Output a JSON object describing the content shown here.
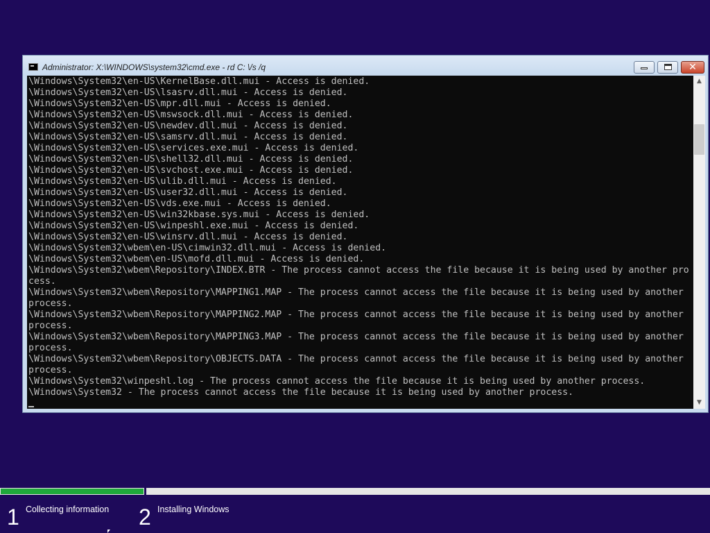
{
  "window": {
    "title": "Administrator: X:\\WINDOWS\\system32\\cmd.exe - rd  C: \\/s /q",
    "minimize_icon": "minimize-icon",
    "maximize_icon": "maximize-icon",
    "close_icon": "close-icon",
    "close_glyph": "✕"
  },
  "console": {
    "lines": [
      "\\Windows\\System32\\en-US\\KernelBase.dll.mui - Access is denied.",
      "\\Windows\\System32\\en-US\\lsasrv.dll.mui - Access is denied.",
      "\\Windows\\System32\\en-US\\mpr.dll.mui - Access is denied.",
      "\\Windows\\System32\\en-US\\mswsock.dll.mui - Access is denied.",
      "\\Windows\\System32\\en-US\\newdev.dll.mui - Access is denied.",
      "\\Windows\\System32\\en-US\\samsrv.dll.mui - Access is denied.",
      "\\Windows\\System32\\en-US\\services.exe.mui - Access is denied.",
      "\\Windows\\System32\\en-US\\shell32.dll.mui - Access is denied.",
      "\\Windows\\System32\\en-US\\svchost.exe.mui - Access is denied.",
      "\\Windows\\System32\\en-US\\ulib.dll.mui - Access is denied.",
      "\\Windows\\System32\\en-US\\user32.dll.mui - Access is denied.",
      "\\Windows\\System32\\en-US\\vds.exe.mui - Access is denied.",
      "\\Windows\\System32\\en-US\\win32kbase.sys.mui - Access is denied.",
      "\\Windows\\System32\\en-US\\winpeshl.exe.mui - Access is denied.",
      "\\Windows\\System32\\en-US\\winsrv.dll.mui - Access is denied.",
      "\\Windows\\System32\\wbem\\en-US\\cimwin32.dll.mui - Access is denied.",
      "\\Windows\\System32\\wbem\\en-US\\mofd.dll.mui - Access is denied.",
      "\\Windows\\System32\\wbem\\Repository\\INDEX.BTR - The process cannot access the file because it is being used by another pro",
      "cess.",
      "\\Windows\\System32\\wbem\\Repository\\MAPPING1.MAP - The process cannot access the file because it is being used by another",
      "process.",
      "\\Windows\\System32\\wbem\\Repository\\MAPPING2.MAP - The process cannot access the file because it is being used by another",
      "process.",
      "\\Windows\\System32\\wbem\\Repository\\MAPPING3.MAP - The process cannot access the file because it is being used by another",
      "process.",
      "\\Windows\\System32\\wbem\\Repository\\OBJECTS.DATA - The process cannot access the file because it is being used by another",
      "process.",
      "\\Windows\\System32\\winpeshl.log - The process cannot access the file because it is being used by another process.",
      "\\Windows\\System32 - The process cannot access the file because it is being used by another process."
    ]
  },
  "scrollbar": {
    "up_glyph": "▲",
    "down_glyph": "▼"
  },
  "setup": {
    "steps": [
      {
        "number": "1",
        "label": "Collecting information"
      },
      {
        "number": "2",
        "label": "Installing Windows"
      }
    ],
    "progress_fraction": 0.2,
    "progress_color": "#1fa83b"
  },
  "colors": {
    "desktop_background": "#1e0a5a",
    "console_background": "#0c0c0c",
    "console_text": "#c0c0c0"
  }
}
